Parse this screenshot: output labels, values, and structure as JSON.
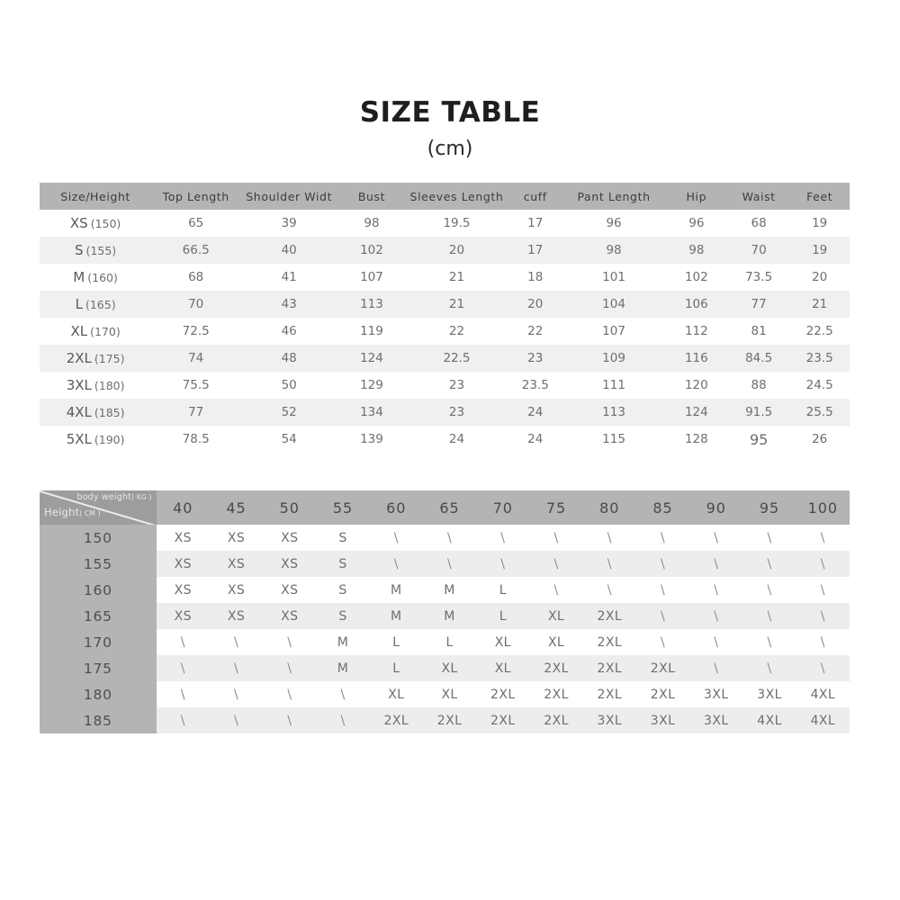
{
  "title": {
    "main": "SIZE TABLE",
    "unit": "(cm)"
  },
  "size_table": {
    "columns": [
      "Size/Height",
      "Top Length",
      "Shoulder Widt",
      "Bust",
      "Sleeves Length",
      "cuff",
      "Pant Length",
      "Hip",
      "Waist",
      "Feet"
    ],
    "rows": [
      {
        "size": "XS",
        "height": "(150)",
        "values": [
          "65",
          "39",
          "98",
          "19.5",
          "17",
          "96",
          "96",
          "68",
          "19"
        ]
      },
      {
        "size": "S",
        "height": "(155)",
        "values": [
          "66.5",
          "40",
          "102",
          "20",
          "17",
          "98",
          "98",
          "70",
          "19"
        ]
      },
      {
        "size": "M",
        "height": "(160)",
        "values": [
          "68",
          "41",
          "107",
          "21",
          "18",
          "101",
          "102",
          "73.5",
          "20"
        ]
      },
      {
        "size": "L",
        "height": "(165)",
        "values": [
          "70",
          "43",
          "113",
          "21",
          "20",
          "104",
          "106",
          "77",
          "21"
        ]
      },
      {
        "size": "XL",
        "height": "(170)",
        "values": [
          "72.5",
          "46",
          "119",
          "22",
          "22",
          "107",
          "112",
          "81",
          "22.5"
        ]
      },
      {
        "size": "2XL",
        "height": "(175)",
        "values": [
          "74",
          "48",
          "124",
          "22.5",
          "23",
          "109",
          "116",
          "84.5",
          "23.5"
        ]
      },
      {
        "size": "3XL",
        "height": "(180)",
        "values": [
          "75.5",
          "50",
          "129",
          "23",
          "23.5",
          "111",
          "120",
          "88",
          "24.5"
        ]
      },
      {
        "size": "4XL",
        "height": "(185)",
        "values": [
          "77",
          "52",
          "134",
          "23",
          "24",
          "113",
          "124",
          "91.5",
          "25.5"
        ]
      },
      {
        "size": "5XL",
        "height": "(190)",
        "values": [
          "78.5",
          "54",
          "139",
          "24",
          "24",
          "115",
          "128",
          "95",
          "26"
        ]
      }
    ]
  },
  "recommend_table": {
    "corner": {
      "weight_label": "body weight",
      "weight_unit": "( KG )",
      "height_label": "Height",
      "height_unit": "( CM )"
    },
    "weights": [
      "40",
      "45",
      "50",
      "55",
      "60",
      "65",
      "70",
      "75",
      "80",
      "85",
      "90",
      "95",
      "100"
    ],
    "rows": [
      {
        "height": "150",
        "values": [
          "XS",
          "XS",
          "XS",
          "S",
          "\\",
          "\\",
          "\\",
          "\\",
          "\\",
          "\\",
          "\\",
          "\\",
          "\\"
        ]
      },
      {
        "height": "155",
        "values": [
          "XS",
          "XS",
          "XS",
          "S",
          "\\",
          "\\",
          "\\",
          "\\",
          "\\",
          "\\",
          "\\",
          "\\",
          "\\"
        ]
      },
      {
        "height": "160",
        "values": [
          "XS",
          "XS",
          "XS",
          "S",
          "M",
          "M",
          "L",
          "\\",
          "\\",
          "\\",
          "\\",
          "\\",
          "\\"
        ]
      },
      {
        "height": "165",
        "values": [
          "XS",
          "XS",
          "XS",
          "S",
          "M",
          "M",
          "L",
          "XL",
          "2XL",
          "\\",
          "\\",
          "\\",
          "\\"
        ]
      },
      {
        "height": "170",
        "values": [
          "\\",
          "\\",
          "\\",
          "M",
          "L",
          "L",
          "XL",
          "XL",
          "2XL",
          "\\",
          "\\",
          "\\",
          "\\"
        ]
      },
      {
        "height": "175",
        "values": [
          "\\",
          "\\",
          "\\",
          "M",
          "L",
          "XL",
          "XL",
          "2XL",
          "2XL",
          "2XL",
          "\\",
          "\\",
          "\\"
        ]
      },
      {
        "height": "180",
        "values": [
          "\\",
          "\\",
          "\\",
          "\\",
          "XL",
          "XL",
          "2XL",
          "2XL",
          "2XL",
          "2XL",
          "3XL",
          "3XL",
          "4XL"
        ]
      },
      {
        "height": "185",
        "values": [
          "\\",
          "\\",
          "\\",
          "\\",
          "2XL",
          "2XL",
          "2XL",
          "2XL",
          "3XL",
          "3XL",
          "3XL",
          "4XL",
          "4XL"
        ]
      }
    ]
  },
  "colors": {
    "header_gray": "#b4b4b4",
    "corner_gray": "#9d9d9d",
    "stripe_gray": "#f0f0f0",
    "stripe_gray2": "#ededed",
    "text_gray": "#6e6e6e",
    "title_black": "#1e1e1e",
    "page_bg": "#ffffff"
  }
}
